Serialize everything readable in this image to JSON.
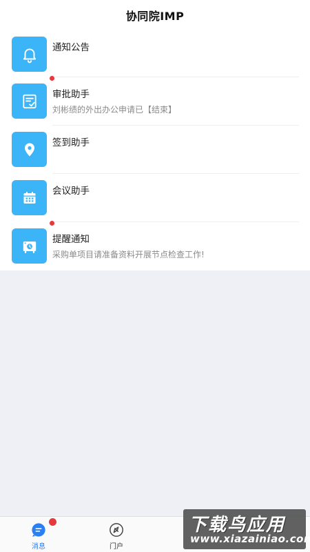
{
  "header": {
    "title": "协同院IMP"
  },
  "list": [
    {
      "title": "通知公告",
      "subtitle": "",
      "icon": "bell-icon",
      "unread": false
    },
    {
      "title": "审批助手",
      "subtitle": "刘彬绩的外出办公申请已【结束】",
      "icon": "approval-icon",
      "unread": true
    },
    {
      "title": "签到助手",
      "subtitle": "",
      "icon": "location-pin-icon",
      "unread": false
    },
    {
      "title": "会议助手",
      "subtitle": "",
      "icon": "calendar-icon",
      "unread": false
    },
    {
      "title": "提醒通知",
      "subtitle": "采购单项目请准备资料开展节点检查工作!",
      "icon": "reminder-icon",
      "unread": true
    }
  ],
  "tabs": [
    {
      "label": "消息",
      "icon": "message-icon",
      "active": true,
      "badge": true
    },
    {
      "label": "门户",
      "icon": "portal-icon",
      "active": false,
      "badge": false
    }
  ],
  "watermark": {
    "cn": "下载鸟应用",
    "en": "www.xiazainiao.com"
  },
  "colors": {
    "accent": "#3bb4f8",
    "badge": "#e5393e",
    "active_tab": "#2a7ff5",
    "background": "#eef0f5"
  }
}
